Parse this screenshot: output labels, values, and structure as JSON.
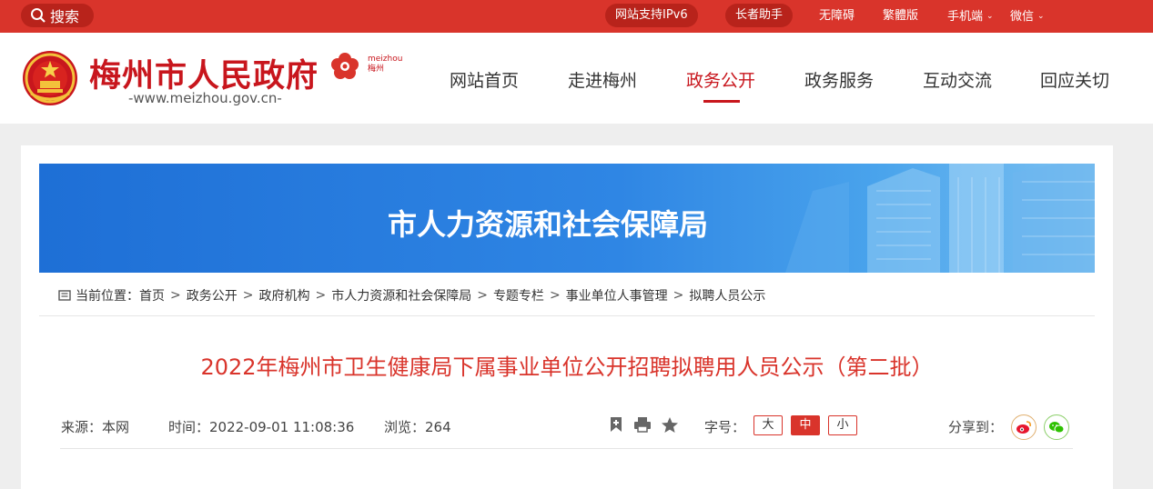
{
  "topbar": {
    "search_label": "搜索",
    "ipv6_label": "网站支持IPv6",
    "elder_label": "长者助手",
    "accessible_label": "无障碍",
    "traditional_label": "繁體版",
    "mobile_label": "手机端",
    "wechat_label": "微信"
  },
  "header": {
    "site_title": "梅州市人民政府",
    "site_url": "-www.meizhou.gov.cn-",
    "logo_text_en": "meizhou",
    "logo_text_cn": "梅州"
  },
  "nav": {
    "items": [
      {
        "label": "网站首页"
      },
      {
        "label": "走进梅州"
      },
      {
        "label": "政务公开"
      },
      {
        "label": "政务服务"
      },
      {
        "label": "互动交流"
      },
      {
        "label": "回应关切"
      }
    ],
    "active": "政务公开"
  },
  "banner": {
    "title": "市人力资源和社会保障局"
  },
  "breadcrumb": {
    "prefix": "当前位置：",
    "items": [
      "首页",
      "政务公开",
      "政府机构",
      "市人力资源和社会保障局",
      "专题专栏",
      "事业单位人事管理",
      "拟聘人员公示"
    ]
  },
  "article": {
    "title": "2022年梅州市卫生健康局下属事业单位公开招聘拟聘用人员公示（第二批）",
    "source": "来源：本网",
    "time": "时间：2022-09-01 11:08:36",
    "views": "浏览：264",
    "font_size_label": "字号：",
    "font_sizes": [
      "大",
      "中",
      "小"
    ],
    "share_label": "分享到："
  },
  "colors": {
    "brand_red": "#d9342b",
    "banner_blue": "#2f86e4"
  }
}
